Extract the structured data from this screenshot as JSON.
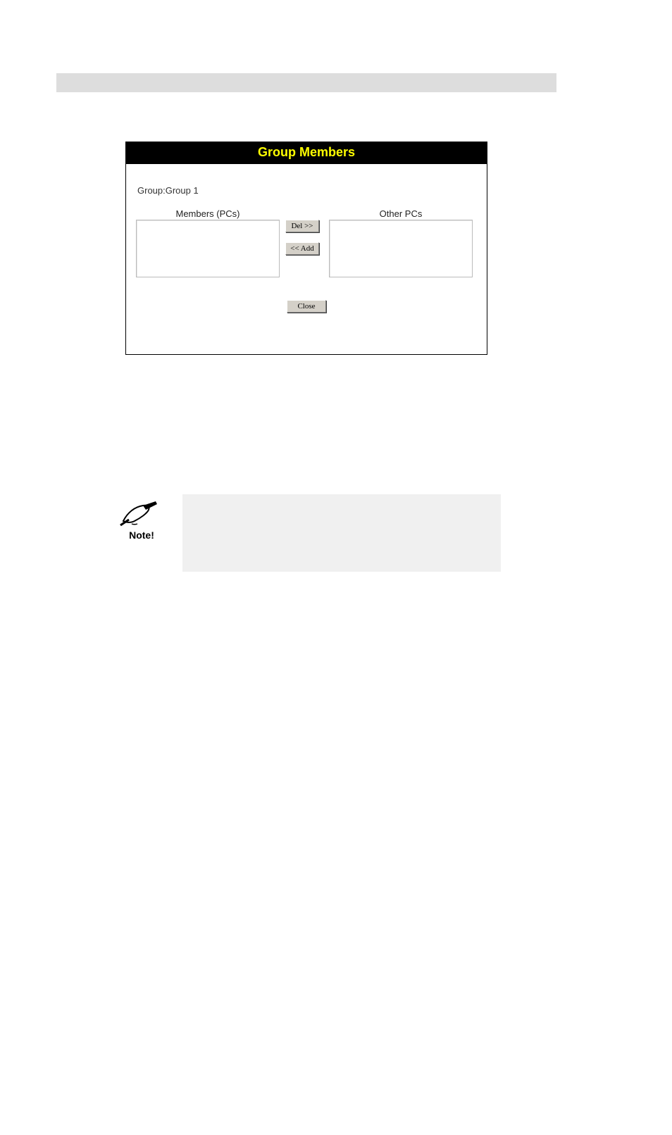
{
  "dialog": {
    "title": "Group Members",
    "group_line": "Group:Group 1",
    "members_label": "Members (PCs)",
    "others_label": "Other PCs",
    "del_btn": "Del >>",
    "add_btn": "<< Add",
    "close_btn": "Close"
  },
  "note": {
    "label": "Note!"
  }
}
